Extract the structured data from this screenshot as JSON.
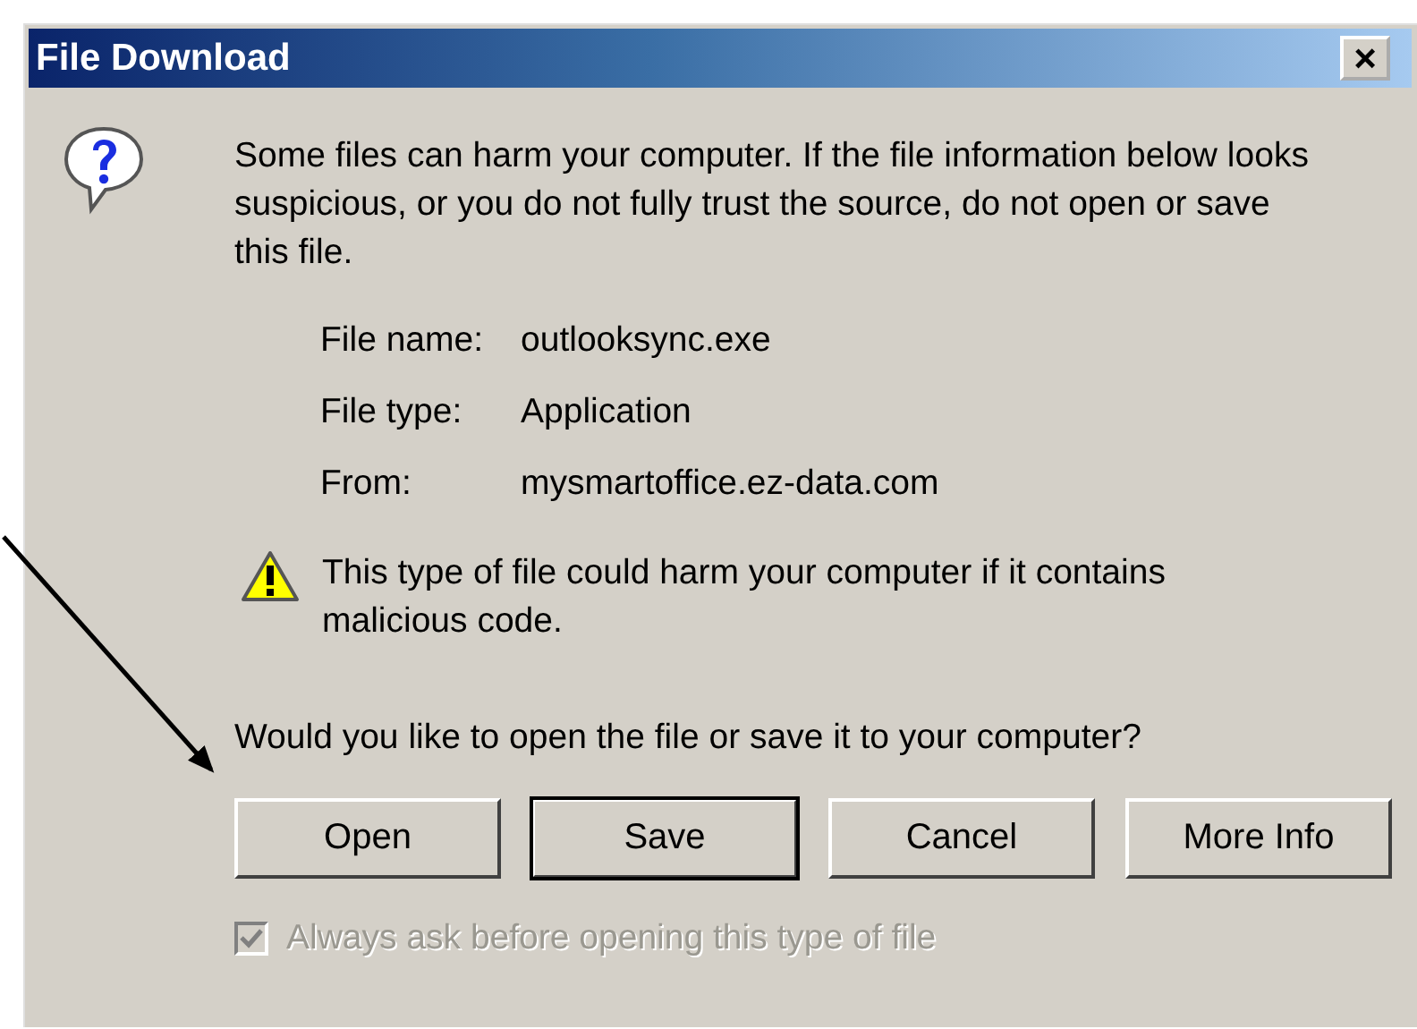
{
  "window": {
    "title": "File Download",
    "close": "×"
  },
  "message": "Some files can harm your computer. If the file information below looks suspicious, or you do not fully trust the source, do not open or save this file.",
  "fields": [
    {
      "label": "File name:",
      "value": "outlooksync.exe"
    },
    {
      "label": "File type:",
      "value": "Application"
    },
    {
      "label": "From:",
      "value": "mysmartoffice.ez-data.com"
    }
  ],
  "warning": "This type of file could harm your computer if it contains malicious code.",
  "question": "Would you like to open the file or save it to your computer?",
  "buttons": [
    {
      "label": "Open",
      "default": false
    },
    {
      "label": "Save",
      "default": true
    },
    {
      "label": "Cancel",
      "default": false
    },
    {
      "label": "More Info",
      "default": false
    }
  ],
  "checkbox": {
    "label": "Always ask before opening this type of file",
    "checked": true,
    "disabled": true
  },
  "annotation": {
    "kind": "arrow"
  }
}
